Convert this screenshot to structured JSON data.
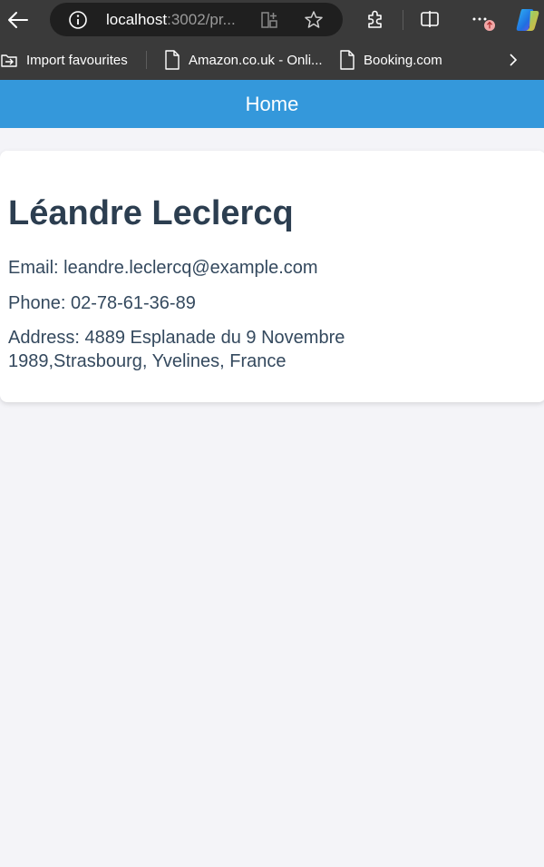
{
  "browser": {
    "url_host": "localhost",
    "url_path": ":3002/pr...",
    "bookmarks": [
      {
        "label": "Import favourites"
      },
      {
        "label": "Amazon.co.uk - Onli..."
      },
      {
        "label": "Booking.com"
      }
    ],
    "icons": [
      "back-arrow-icon",
      "info-icon",
      "tab-grid-icon",
      "star-icon",
      "extensions-icon",
      "split-screen-icon",
      "more-icon",
      "copilot-icon",
      "chevron-right-icon"
    ],
    "accent_color": "#3498db"
  },
  "header": {
    "title": "Home"
  },
  "profile": {
    "name": "Léandre Leclercq",
    "email_line": "Email: leandre.leclercq@example.com",
    "phone_line": "Phone: 02-78-61-36-89",
    "address_line1": "Address: 4889 Esplanade du 9 Novembre",
    "address_line2": "1989,Strasbourg, Yvelines, France"
  }
}
